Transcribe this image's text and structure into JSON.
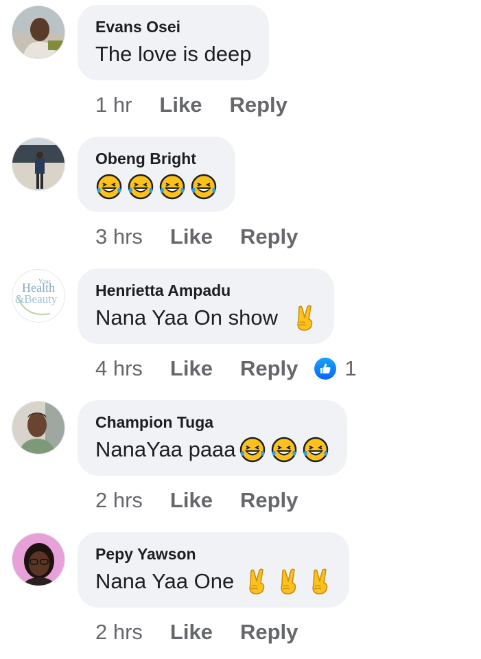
{
  "comments": [
    {
      "author": "Evans Osei",
      "text": "The love is deep",
      "emojis": [],
      "time": "1 hr",
      "like": "Like",
      "reply": "Reply",
      "reactions": ""
    },
    {
      "author": "Obeng Bright",
      "text": "",
      "emojis": [
        "laughing-tears",
        "laughing-tears",
        "laughing-tears",
        "laughing-tears"
      ],
      "time": "3 hrs",
      "like": "Like",
      "reply": "Reply",
      "reactions": ""
    },
    {
      "author": "Henrietta Ampadu",
      "text": "Nana Yaa On show",
      "emojis": [
        "victory-hand"
      ],
      "time": "4 hrs",
      "like": "Like",
      "reply": "Reply",
      "reactions": "1"
    },
    {
      "author": "Champion Tuga",
      "text": "NanaYaa paaa",
      "emojis": [
        "laughing-tears",
        "laughing-tears",
        "laughing-tears"
      ],
      "time": "2 hrs",
      "like": "Like",
      "reply": "Reply",
      "reactions": ""
    },
    {
      "author": "Pepy Yawson",
      "text": "Nana Yaa One",
      "emojis": [
        "victory-hand",
        "victory-hand",
        "victory-hand"
      ],
      "time": "2 hrs",
      "like": "Like",
      "reply": "Reply",
      "reactions": ""
    }
  ],
  "avatar3_logo": {
    "line1": "Your",
    "line2": "Health",
    "line3": "&Beauty"
  },
  "icons": {
    "reaction": "like-thumb-icon",
    "laugh": "laughing-tears-emoji",
    "peace": "victory-hand-emoji"
  },
  "colors": {
    "bubble": "#f0f2f5",
    "meta": "#65676b",
    "like_blue": "#0866ff"
  }
}
